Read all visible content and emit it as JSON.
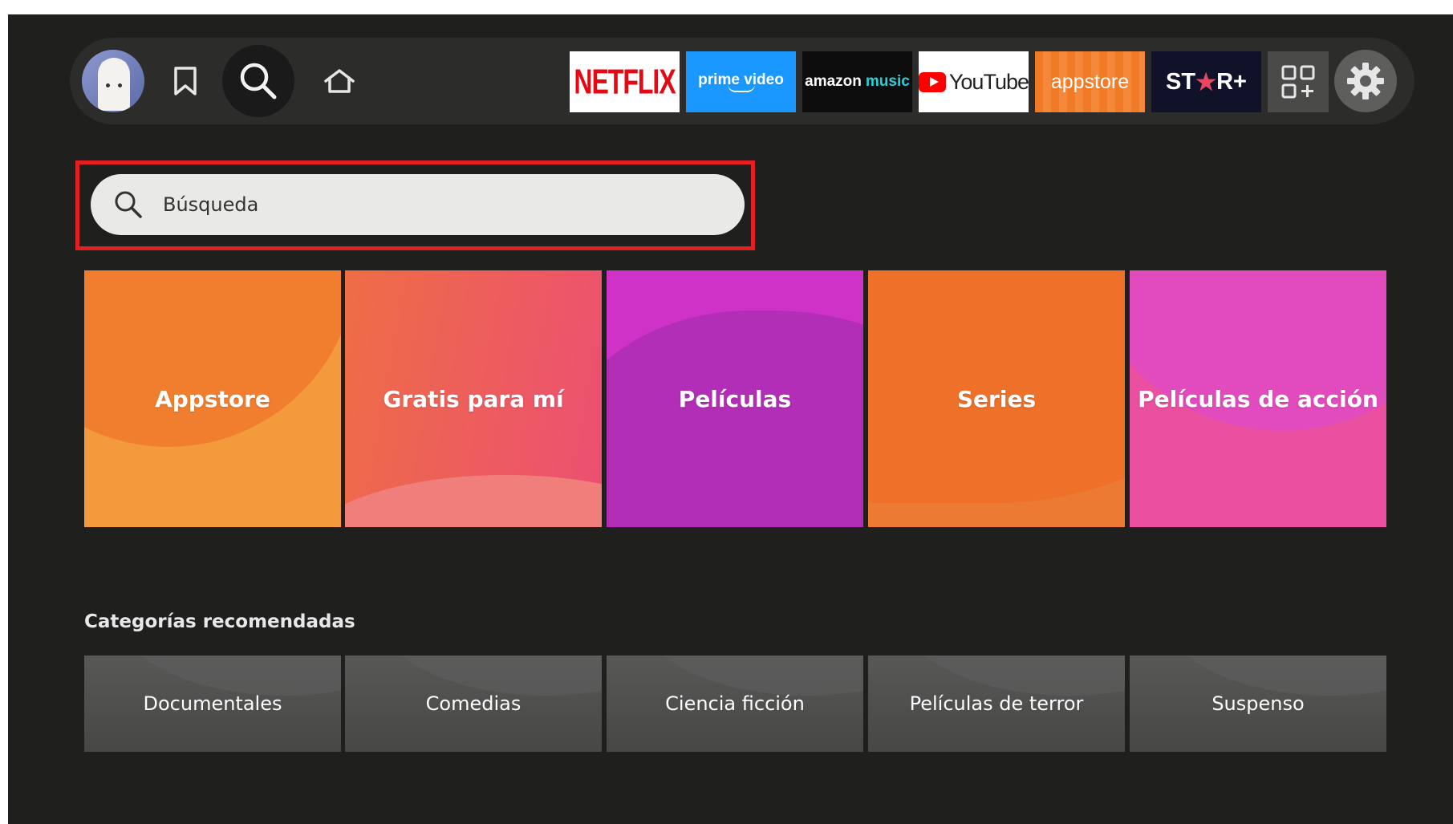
{
  "nav": {
    "apps": {
      "netflix": "NETFLIX",
      "prime_video": "prime video",
      "amazon_music_1": "amazon",
      "amazon_music_2": "music",
      "youtube": "YouTube",
      "appstore": "appstore",
      "star_plus_1": "ST",
      "star_plus_star": "★",
      "star_plus_2": "R+"
    },
    "icons": [
      "profile-avatar",
      "bookmark-icon",
      "search-icon",
      "home-icon",
      "apps-grid-icon",
      "gear-icon"
    ]
  },
  "search": {
    "placeholder": "Búsqueda"
  },
  "categories": [
    {
      "label": "Appstore"
    },
    {
      "label": "Gratis para mí"
    },
    {
      "label": "Películas"
    },
    {
      "label": "Series"
    },
    {
      "label": "Películas de acción"
    }
  ],
  "recommended": {
    "title": "Categorías recomendadas",
    "items": [
      {
        "label": "Documentales"
      },
      {
        "label": "Comedias"
      },
      {
        "label": "Ciencia ficción"
      },
      {
        "label": "Películas de terror"
      },
      {
        "label": "Suspenso"
      }
    ]
  },
  "colors": {
    "background": "#1f1f1e",
    "highlight": "#e2201f",
    "netflix_red": "#e50914",
    "prime_blue": "#1a98ff"
  }
}
